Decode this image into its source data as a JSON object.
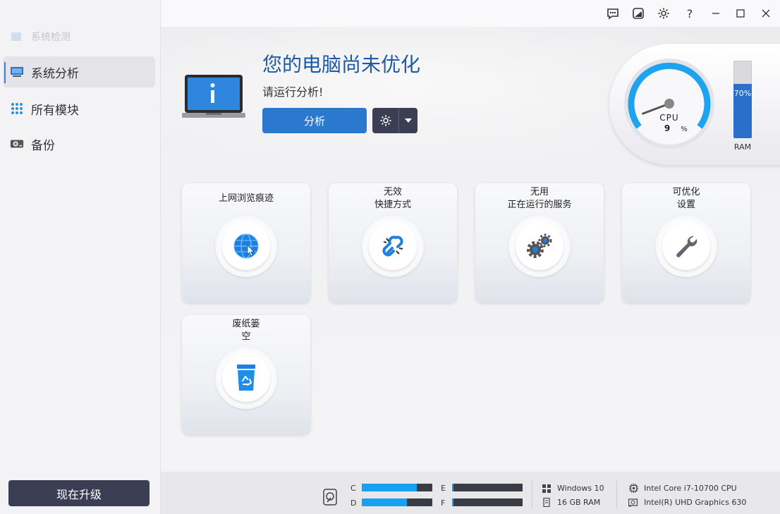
{
  "sidebar": {
    "ghost_item": "系统检测",
    "items": [
      {
        "label": "系统分析",
        "active": true
      },
      {
        "label": "所有模块",
        "active": false
      },
      {
        "label": "备份",
        "active": false
      }
    ],
    "upgrade_label": "现在升级"
  },
  "titlebar": {
    "icons": [
      "feedback-icon",
      "theme-icon",
      "settings-icon",
      "help-icon",
      "minimize-icon",
      "maximize-icon",
      "close-icon"
    ],
    "help_glyph": "?"
  },
  "hero": {
    "title": "您的电脑尚未优化",
    "subtitle": "请运行分析!",
    "analyze_label": "分析"
  },
  "gauge": {
    "cpu_label": "CPU",
    "cpu_value": "9",
    "cpu_unit": "%",
    "cpu_fraction": 0.09,
    "ram_pct_label": "70%",
    "ram_fraction": 0.7,
    "ram_label": "RAM"
  },
  "tiles": [
    {
      "label_line1": "上网浏览痕迹",
      "label_line2": "",
      "icon": "globe-cursor-icon"
    },
    {
      "label_line1": "无效",
      "label_line2": "快捷方式",
      "icon": "broken-link-icon"
    },
    {
      "label_line1": "无用",
      "label_line2": "正在运行的服务",
      "icon": "gears-icon"
    },
    {
      "label_line1": "可优化",
      "label_line2": "设置",
      "icon": "wrench-icon"
    },
    {
      "label_line1": "废纸篓",
      "label_line2": "空",
      "icon": "recycle-bin-icon"
    }
  ],
  "status": {
    "drives": [
      {
        "letter": "C",
        "fill": 0.78
      },
      {
        "letter": "D",
        "fill": 0.64
      },
      {
        "letter": "E",
        "fill": 0.02
      },
      {
        "letter": "F",
        "fill": 0.02
      }
    ],
    "os": "Windows 10",
    "ram": "16 GB RAM",
    "cpu": "Intel Core i7-10700 CPU",
    "gpu": "Intel(R) UHD Graphics 630"
  },
  "colors": {
    "accent": "#2a79cf",
    "title_blue": "#1e5aa6",
    "dark_button": "#3c3f54",
    "drive_fill": "#1aa0f0"
  }
}
